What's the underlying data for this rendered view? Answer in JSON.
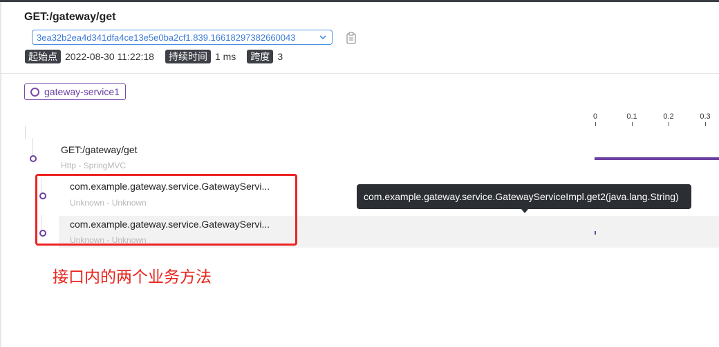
{
  "header": {
    "title": "GET:/gateway/get",
    "trace_id": "3ea32b2ea4d341dfa4ce13e5e0ba2cf1.839.16618297382660043",
    "start_label": "起始点",
    "start_value": "2022-08-30 11:22:18",
    "duration_label": "持续时间",
    "duration_value": "1 ms",
    "span_label": "跨度",
    "span_value": "3"
  },
  "service": {
    "name": "gateway-service1"
  },
  "timeline": {
    "ticks": [
      "0",
      "0.1",
      "0.2",
      "0.3"
    ]
  },
  "spans": [
    {
      "name": "GET:/gateway/get",
      "sub": "Http - SpringMVC"
    },
    {
      "name": "com.example.gateway.service.GatewayServi...",
      "sub": "Unknown - Unknown"
    },
    {
      "name": "com.example.gateway.service.GatewayServi...",
      "sub": "Unknown - Unknown"
    }
  ],
  "tooltip": {
    "text": "com.example.gateway.service.GatewayServiceImpl.get2(java.lang.String)"
  },
  "annotation": {
    "text": "接口内的两个业务方法"
  },
  "colors": {
    "accent": "#6b3fa0",
    "link": "#3b7ad9",
    "annotation": "#e8231c",
    "tag_bg": "#3d4047"
  },
  "icons": {
    "copy": "clipboard-icon",
    "chevron": "chevron-down-icon",
    "service": "circle-icon"
  }
}
